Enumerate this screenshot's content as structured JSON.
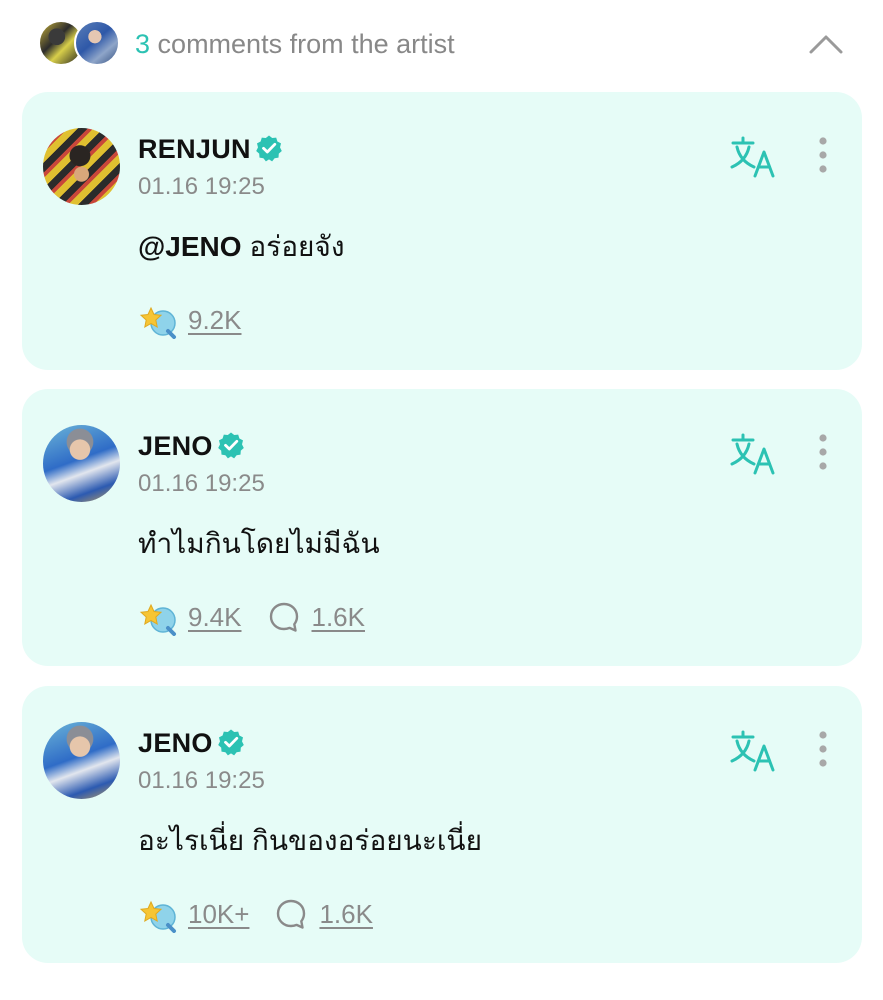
{
  "header": {
    "count": "3",
    "label": "comments from the artist",
    "avatars": [
      "renjun-avatar",
      "jeno-avatar"
    ]
  },
  "icons": {
    "verified": "verified-badge-icon",
    "translate": "translate-icon",
    "more": "more-vertical-icon",
    "like": "sticker-like-icon",
    "comment": "comment-bubble-icon",
    "collapse": "chevron-up-icon"
  },
  "colors": {
    "accent": "#2cc2b3",
    "card_background": "#e6fcf7",
    "muted_text": "#8a8a8a"
  },
  "comments": [
    {
      "author": "RENJUN",
      "time": "01.16 19:25",
      "mention": "@JENO",
      "text": " อร่อยจัง",
      "likes": "9.2K",
      "replies": null
    },
    {
      "author": "JENO",
      "time": "01.16 19:25",
      "mention": "",
      "text": "ทำไมกินโดยไม่มีฉัน",
      "likes": "9.4K",
      "replies": "1.6K"
    },
    {
      "author": "JENO",
      "time": "01.16 19:25",
      "mention": "",
      "text": "อะไรเนี่ย กินของอร่อยนะเนี่ย",
      "likes": "10K+",
      "replies": "1.6K"
    }
  ]
}
